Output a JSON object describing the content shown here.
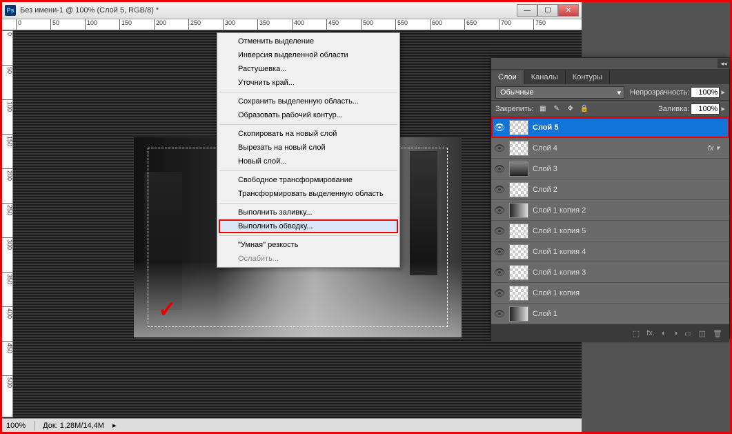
{
  "window": {
    "title": "Без имени-1 @ 100% (Слой 5, RGB/8) *",
    "ps_label": "Ps"
  },
  "ruler_h": [
    0,
    50,
    100,
    150,
    200,
    250,
    300,
    350,
    400,
    450,
    500,
    550,
    600,
    650,
    700,
    750
  ],
  "ruler_v": [
    0,
    50,
    100,
    150,
    200,
    250,
    300,
    350,
    400,
    450,
    500
  ],
  "status": {
    "zoom": "100%",
    "docsize": "Док: 1,28M/14,4M"
  },
  "context_menu": {
    "items": [
      {
        "label": "Отменить выделение",
        "type": "item"
      },
      {
        "label": "Инверсия выделенной области",
        "type": "item"
      },
      {
        "label": "Растушевка...",
        "type": "item"
      },
      {
        "label": "Уточнить край...",
        "type": "item"
      },
      {
        "type": "sep"
      },
      {
        "label": "Сохранить выделенную область...",
        "type": "item"
      },
      {
        "label": "Образовать рабочий контур...",
        "type": "item"
      },
      {
        "type": "sep"
      },
      {
        "label": "Скопировать на новый слой",
        "type": "item"
      },
      {
        "label": "Вырезать на новый слой",
        "type": "item"
      },
      {
        "label": "Новый слой...",
        "type": "item"
      },
      {
        "type": "sep"
      },
      {
        "label": "Свободное трансформирование",
        "type": "item"
      },
      {
        "label": "Трансформировать выделенную область",
        "type": "item"
      },
      {
        "type": "sep"
      },
      {
        "label": "Выполнить заливку...",
        "type": "item"
      },
      {
        "label": "Выполнить обводку...",
        "type": "highlight"
      },
      {
        "type": "sep"
      },
      {
        "label": "\"Умная\" резкость",
        "type": "item"
      },
      {
        "label": "Ослабить...",
        "type": "disabled"
      }
    ]
  },
  "layers_panel": {
    "tabs": [
      "Слои",
      "Каналы",
      "Контуры"
    ],
    "blend_mode": "Обычные",
    "opacity_label": "Непрозрачность:",
    "opacity": "100%",
    "lock_label": "Закрепить:",
    "fill_label": "Заливка:",
    "fill": "100%",
    "layers": [
      {
        "name": "Слой 5",
        "selected": true,
        "thumb": "checker"
      },
      {
        "name": "Слой 4",
        "thumb": "checker",
        "fx": true
      },
      {
        "name": "Слой 3",
        "thumb": "img"
      },
      {
        "name": "Слой 2",
        "thumb": "checker"
      },
      {
        "name": "Слой 1 копия 2",
        "thumb": "grad"
      },
      {
        "name": "Слой 1 копия 5",
        "thumb": "checker"
      },
      {
        "name": "Слой 1 копия 4",
        "thumb": "checker"
      },
      {
        "name": "Слой 1 копия 3",
        "thumb": "checker"
      },
      {
        "name": "Слой 1 копия",
        "thumb": "checker"
      },
      {
        "name": "Слой 1",
        "thumb": "grad"
      }
    ],
    "footer_icons": [
      "⬚",
      "fx.",
      "◐",
      "◑",
      "▭",
      "◫",
      "🗑"
    ]
  }
}
